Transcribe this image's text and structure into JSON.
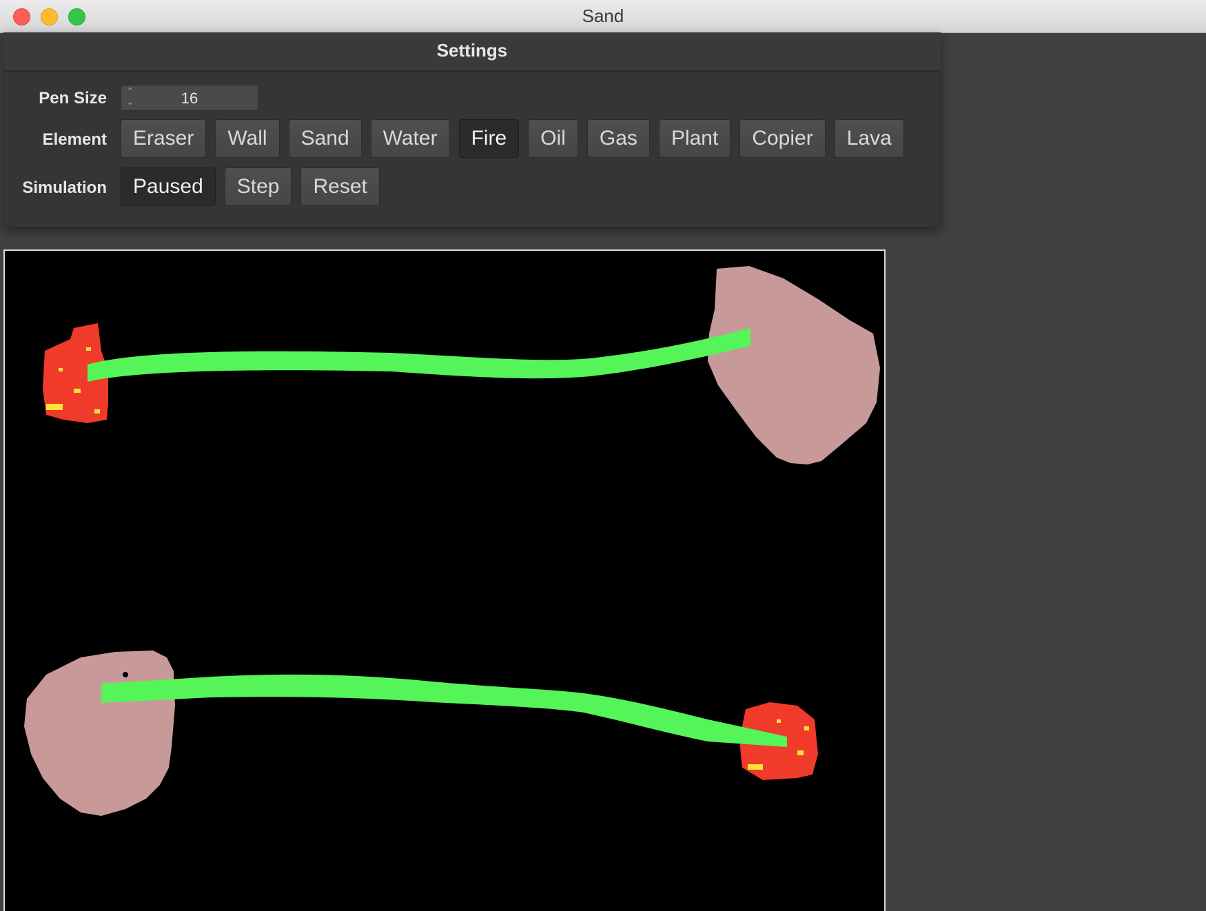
{
  "window": {
    "title": "Sand"
  },
  "settings": {
    "title": "Settings",
    "pen_size": {
      "label": "Pen Size",
      "value": "16"
    },
    "element": {
      "label": "Element",
      "options": [
        "Eraser",
        "Wall",
        "Sand",
        "Water",
        "Fire",
        "Oil",
        "Gas",
        "Plant",
        "Copier",
        "Lava"
      ],
      "selected": "Fire"
    },
    "simulation": {
      "label": "Simulation",
      "buttons": [
        "Paused",
        "Step",
        "Reset"
      ],
      "active": "Paused"
    }
  },
  "colors": {
    "plant": "#55f55a",
    "wall": "#c89999",
    "fire": "#f03b2a",
    "fire_spark": "#ffe23a",
    "canvas_bg": "#000000"
  }
}
